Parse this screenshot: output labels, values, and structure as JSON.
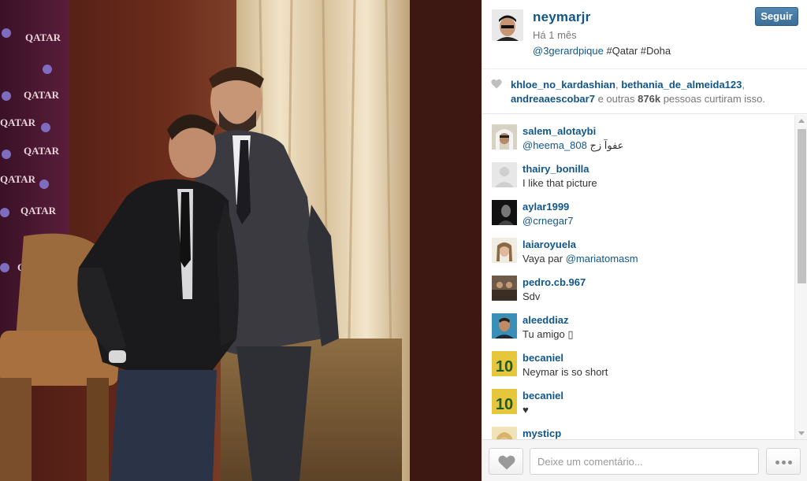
{
  "post": {
    "username": "neymarjr",
    "time": "Há 1 mês",
    "caption_mention": "@3gerardpique",
    "caption_tags": " #Qatar #Doha",
    "follow_label": "Seguir",
    "photo_banner_text": "QATAR"
  },
  "likes": {
    "user1": "khloe_no_kardashian",
    "sep1": ", ",
    "user2": "bethania_de_almeida123",
    "sep2": ",",
    "user3": "andreaaescobar7",
    "mid_text": " e outras ",
    "count": "876k",
    "end_text": " pessoas curtiram isso."
  },
  "comments": [
    {
      "user": "salem_alotaybi",
      "mention": "@heema_808",
      "text": " عفوآ زج"
    },
    {
      "user": "thairy_bonilla",
      "mention": "",
      "text": "I like that picture"
    },
    {
      "user": "aylar1999",
      "mention": "@crnegar7",
      "text": ""
    },
    {
      "user": "laiaroyuela",
      "mention": "@mariatomasm",
      "text": "Vaya par "
    },
    {
      "user": "pedro.cb.967",
      "mention": "",
      "text": "Sdv"
    },
    {
      "user": "aleeddiaz",
      "mention": "",
      "text": "Tu amigo ▯"
    },
    {
      "user": "becaniel",
      "mention": "",
      "text": "Neymar is so short"
    },
    {
      "user": "becaniel",
      "mention": "",
      "text": "♥"
    },
    {
      "user": "mysticp",
      "mention": "",
      "text": ""
    }
  ],
  "avatar_jersey_number": "10",
  "footer": {
    "comment_placeholder": "Deixe um comentário..."
  },
  "icons": {
    "like": "heart-icon",
    "more": "ellipsis-icon",
    "scroll_up": "arrow-up-icon",
    "scroll_down": "arrow-down-icon"
  },
  "colors": {
    "link": "#125688",
    "follow_button": "#3f729b",
    "muted_text": "#777777"
  }
}
